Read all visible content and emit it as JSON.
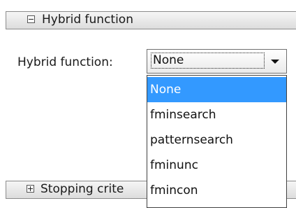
{
  "hybrid_panel": {
    "title": "Hybrid function",
    "expander_icon": "minus-box-icon"
  },
  "hybrid_field": {
    "label": "Hybrid function:",
    "selected_value": "None",
    "options": [
      "None",
      "fminsearch",
      "patternsearch",
      "fminunc",
      "fmincon"
    ],
    "highlighted_index": 0
  },
  "stopping_panel": {
    "title": "Stopping crite",
    "expander_icon": "plus-box-icon"
  },
  "colors": {
    "highlight": "#3399ff",
    "highlight_text": "#ffffff"
  }
}
